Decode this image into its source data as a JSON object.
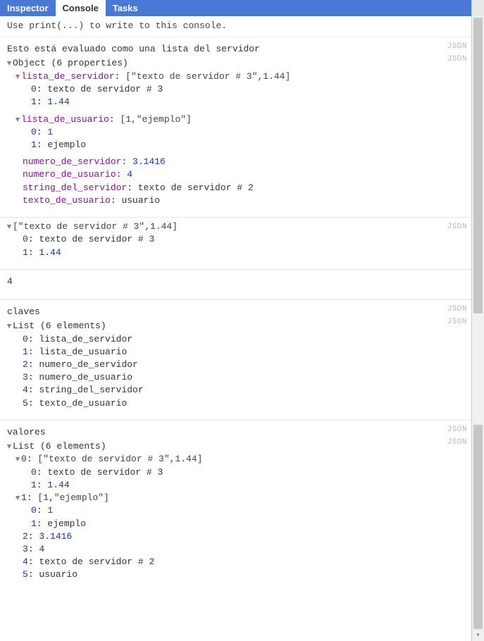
{
  "tabs": {
    "inspector": "Inspector",
    "console": "Console",
    "tasks": "Tasks"
  },
  "hint": "Use print(...) to write to this console.",
  "json_badge": "JSON",
  "glyphs": {
    "down": "▼",
    "right": "▶"
  },
  "b1": {
    "title": "Esto está evaluado como una lista del servidor",
    "summary": "Object (6 properties)",
    "lista_de_servidor": {
      "key": "lista_de_servidor",
      "preview": "[\"texto de servidor # 3\",1.44]",
      "items": [
        {
          "idx": "0",
          "val": "texto de servidor # 3",
          "type": "str"
        },
        {
          "idx": "1",
          "val": "1.44",
          "type": "num"
        }
      ]
    },
    "lista_de_usuario": {
      "key": "lista_de_usuario",
      "preview": "[1,\"ejemplo\"]",
      "items": [
        {
          "idx": "0",
          "val": "1",
          "type": "num"
        },
        {
          "idx": "1",
          "val": "ejemplo",
          "type": "str"
        }
      ]
    },
    "numero_de_servidor": {
      "key": "numero_de_servidor",
      "val": "3.1416"
    },
    "numero_de_usuario": {
      "key": "numero_de_usuario",
      "val": "4"
    },
    "string_del_servidor": {
      "key": "string_del_servidor",
      "val": "texto de servidor # 2"
    },
    "texto_de_usuario": {
      "key": "texto_de_usuario",
      "val": "usuario"
    }
  },
  "b2": {
    "preview": "[\"texto de servidor # 3\",1.44]",
    "items": [
      {
        "idx": "0",
        "val": "texto de servidor # 3",
        "type": "str"
      },
      {
        "idx": "1",
        "val": "1.44",
        "type": "num"
      }
    ]
  },
  "b3": {
    "value": "4"
  },
  "b4": {
    "title": "claves",
    "summary": "List (6 elements)",
    "items": [
      {
        "idx": "0",
        "val": "lista_de_servidor"
      },
      {
        "idx": "1",
        "val": "lista_de_usuario"
      },
      {
        "idx": "2",
        "val": "numero_de_servidor"
      },
      {
        "idx": "3",
        "val": "numero_de_usuario"
      },
      {
        "idx": "4",
        "val": "string_del_servidor"
      },
      {
        "idx": "5",
        "val": "texto_de_usuario"
      }
    ]
  },
  "b5": {
    "title": "valores",
    "summary": "List (6 elements)",
    "e0": {
      "idx": "0",
      "preview": "[\"texto de servidor # 3\",1.44]",
      "items": [
        {
          "idx": "0",
          "val": "texto de servidor # 3",
          "type": "str"
        },
        {
          "idx": "1",
          "val": "1.44",
          "type": "num"
        }
      ]
    },
    "e1": {
      "idx": "1",
      "preview": "[1,\"ejemplo\"]",
      "items": [
        {
          "idx": "0",
          "val": "1",
          "type": "num"
        },
        {
          "idx": "1",
          "val": "ejemplo",
          "type": "str"
        }
      ]
    },
    "rest": [
      {
        "idx": "2",
        "val": "3.1416",
        "type": "num"
      },
      {
        "idx": "3",
        "val": "4",
        "type": "num"
      },
      {
        "idx": "4",
        "val": "texto de servidor # 2",
        "type": "str"
      },
      {
        "idx": "5",
        "val": "usuario",
        "type": "str"
      }
    ]
  }
}
